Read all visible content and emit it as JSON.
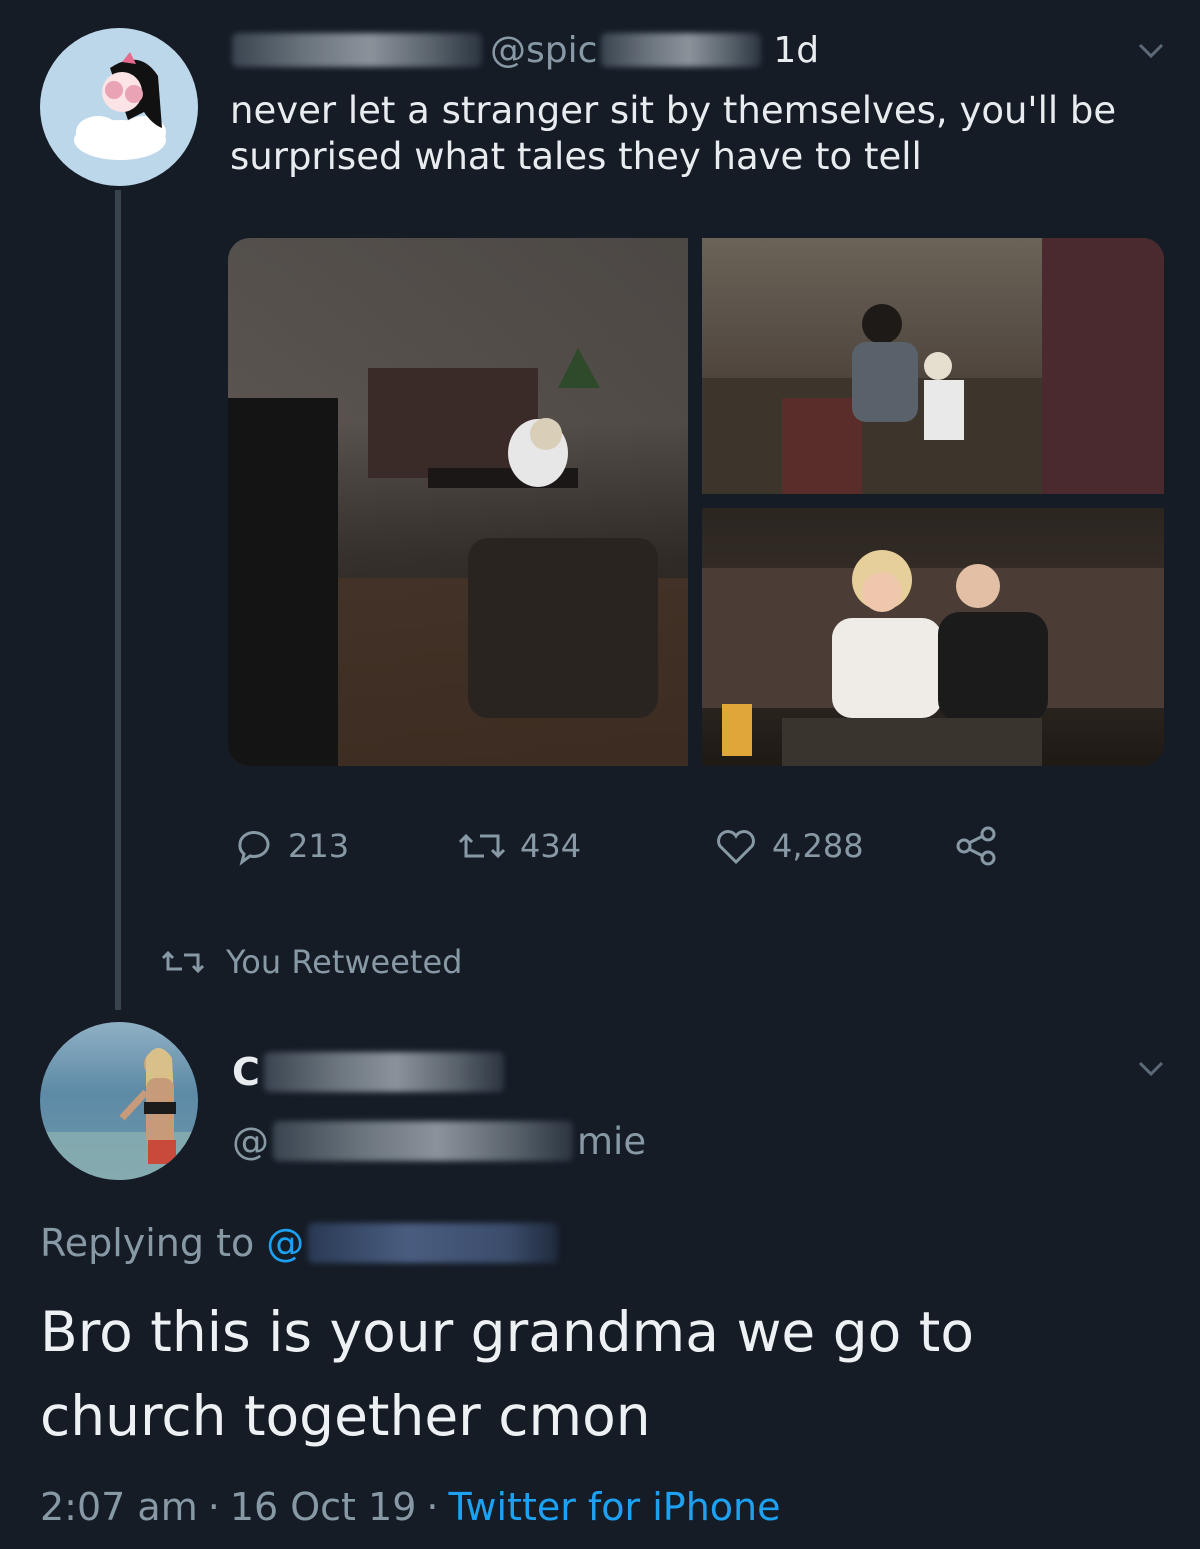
{
  "tweet": {
    "handle": "@spic",
    "age": "1d",
    "text": "never let a stranger sit by themselves, you'll be surprised what tales they have to tell",
    "stats": {
      "replies": "213",
      "retweets": "434",
      "likes": "4,288"
    }
  },
  "retweet_notice": "You Retweeted",
  "reply": {
    "name_visible": "C",
    "handle_prefix": "@",
    "handle_suffix": "mie",
    "replying_to_label": "Replying to",
    "replying_to_at": "@",
    "text": "Bro this is your grandma we go to church together cmon",
    "time": "2:07 am",
    "date": "16 Oct 19",
    "source": "Twitter for iPhone"
  },
  "colors": {
    "background": "#151c26",
    "muted": "#8899a6",
    "link": "#1da1f2"
  }
}
